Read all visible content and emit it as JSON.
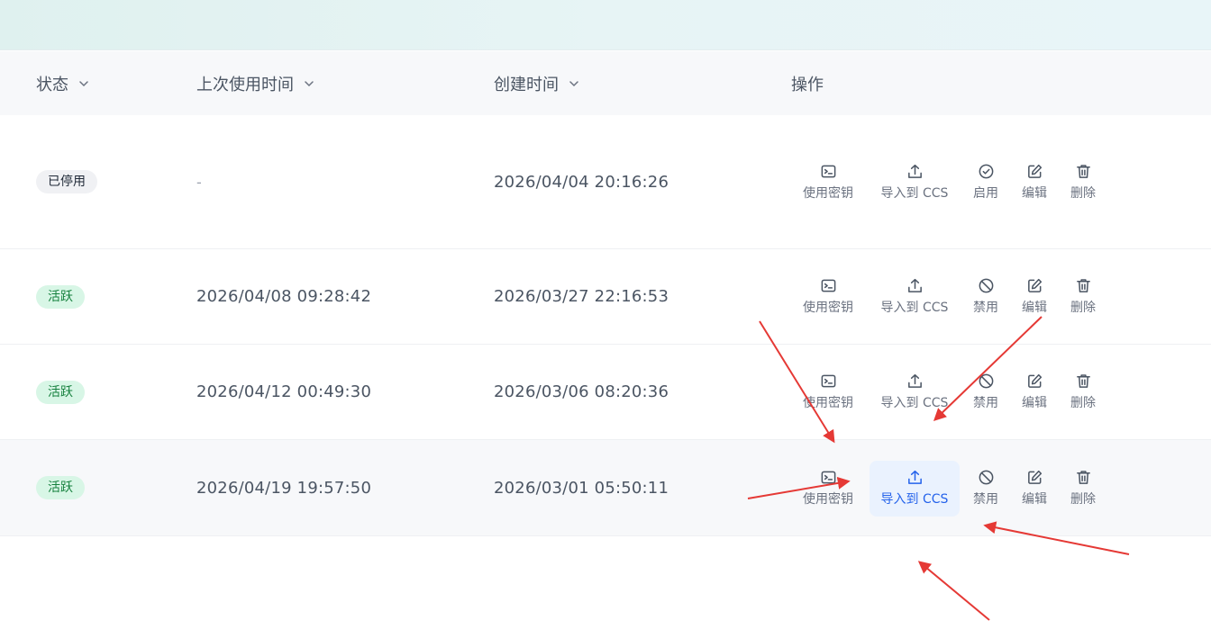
{
  "table": {
    "columns": [
      {
        "label": "状态",
        "sortable": true
      },
      {
        "label": "上次使用时间",
        "sortable": true
      },
      {
        "label": "创建时间",
        "sortable": true
      },
      {
        "label": "操作",
        "sortable": false
      }
    ],
    "rows": [
      {
        "status": "已停用",
        "status_type": "disabled",
        "last_used": "-",
        "created": "2026/04/04 20:16:26",
        "actions": [
          "使用密钥",
          "导入到 CCS",
          "启用",
          "编辑",
          "删除"
        ]
      },
      {
        "status": "活跃",
        "status_type": "active",
        "last_used": "2026/04/08 09:28:42",
        "created": "2026/03/27 22:16:53",
        "actions": [
          "使用密钥",
          "导入到 CCS",
          "禁用",
          "编辑",
          "删除"
        ]
      },
      {
        "status": "活跃",
        "status_type": "active",
        "last_used": "2026/04/12 00:49:30",
        "created": "2026/03/06 08:20:36",
        "actions": [
          "使用密钥",
          "导入到 CCS",
          "禁用",
          "编辑",
          "删除"
        ]
      },
      {
        "status": "活跃",
        "status_type": "active",
        "last_used": "2026/04/19 19:57:50",
        "created": "2026/03/01 05:50:11",
        "actions": [
          "使用密钥",
          "导入到 CCS",
          "禁用",
          "编辑",
          "删除"
        ]
      }
    ]
  },
  "icons": {
    "use_key": "terminal-icon",
    "import": "upload-icon",
    "enable": "check-circle-icon",
    "disable": "ban-icon",
    "edit": "edit-icon",
    "delete": "trash-icon",
    "sort": "chevron-down-icon"
  },
  "colors": {
    "active_badge_bg": "#d8f6e6",
    "active_badge_text": "#15803d",
    "disabled_badge_bg": "#f0f1f4",
    "highlight_text": "#2563eb",
    "highlight_bg": "#eaf2fe",
    "annotation_arrow": "#e53935"
  }
}
